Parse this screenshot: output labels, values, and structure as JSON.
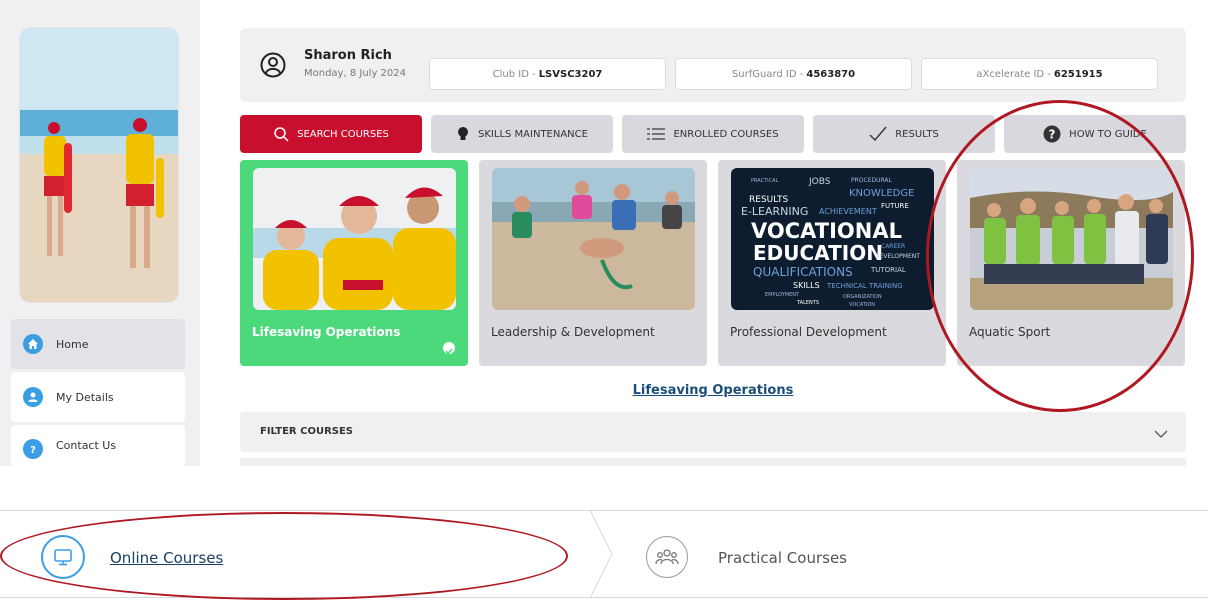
{
  "user": {
    "name": "Sharon Rich",
    "date": "Monday, 8 July 2024"
  },
  "ids": [
    {
      "label": "Club ID - ",
      "value": "LSVSC3207"
    },
    {
      "label": "SurfGuard ID - ",
      "value": "4563870"
    },
    {
      "label": "aXcelerate ID - ",
      "value": "6251915"
    }
  ],
  "sidebar": {
    "items": [
      {
        "label": "Home",
        "icon": "home-icon"
      },
      {
        "label": "My Details",
        "icon": "person-icon"
      },
      {
        "label": "Contact Us",
        "icon": "question-icon"
      }
    ]
  },
  "tabs": [
    {
      "label": "SEARCH COURSES",
      "icon": "search-icon"
    },
    {
      "label": "SKILLS MAINTENANCE",
      "icon": "lightbulb-icon"
    },
    {
      "label": "ENROLLED COURSES",
      "icon": "list-icon"
    },
    {
      "label": "RESULTS",
      "icon": "check-icon"
    },
    {
      "label": "HOW TO GUIDE",
      "icon": "question-icon"
    }
  ],
  "categories": [
    {
      "title": "Lifesaving Operations"
    },
    {
      "title": "Leadership & Development"
    },
    {
      "title": "Professional Development",
      "image_words": [
        "PRACTICAL",
        "JOBS",
        "PROCEDURAL",
        "RESULTS",
        "KNOWLEDGE",
        "E-LEARNING",
        "ACHIEVEMENT",
        "FUTURE",
        "VOCATIONAL",
        "EDUCATION",
        "DEVELOPMENT",
        "QUALIFICATIONS",
        "TUTORIAL",
        "SKILLS",
        "TECHNICAL TRAINING",
        "EMPLOYMENT",
        "ORGANIZATION",
        "TALENTS",
        "VOCATION",
        "CAREER"
      ]
    },
    {
      "title": "Aquatic Sport"
    }
  ],
  "section_title": "Lifesaving Operations",
  "filter": {
    "label": "FILTER COURSES"
  },
  "steps": [
    {
      "label": "Online Courses",
      "icon": "monitor-icon"
    },
    {
      "label": "Practical Courses",
      "icon": "group-icon"
    }
  ],
  "colors": {
    "accent_red": "#c8102e",
    "active_green": "#4cd97b",
    "nav_blue": "#3b9ee4",
    "annotation_red": "#b01821"
  }
}
